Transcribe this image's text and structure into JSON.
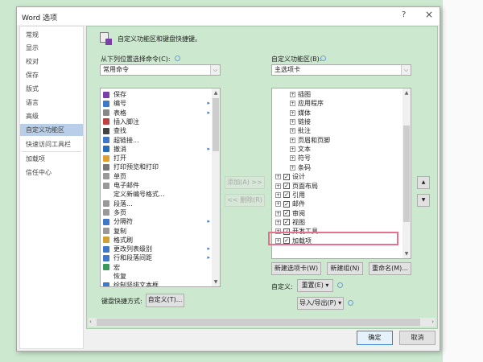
{
  "dialog": {
    "title": "Word 选项",
    "help": "?",
    "close": "×"
  },
  "sidebar": {
    "items": [
      {
        "label": "常规"
      },
      {
        "label": "显示"
      },
      {
        "label": "校对"
      },
      {
        "label": "保存"
      },
      {
        "label": "版式"
      },
      {
        "label": "语言"
      },
      {
        "label": "高级"
      },
      {
        "label": "自定义功能区",
        "selected": true
      },
      {
        "label": "快速访问工具栏"
      },
      {
        "label": "加载项"
      },
      {
        "label": "信任中心"
      }
    ]
  },
  "main": {
    "heading": "自定义功能区和键盘快捷键。",
    "commands_label": "从下列位置选择命令(C):",
    "commands_value": "常用命令",
    "ribbon_label": "自定义功能区(B):",
    "ribbon_value": "主选项卡",
    "commands": [
      {
        "label": "保存",
        "color": "#7a3fa8"
      },
      {
        "label": "编号",
        "color": "#3f78c8",
        "sub": true
      },
      {
        "label": "表格",
        "color": "#888",
        "sub": true
      },
      {
        "label": "插入脚注",
        "color": "#c04040"
      },
      {
        "label": "查找",
        "color": "#444"
      },
      {
        "label": "超链接...",
        "color": "#3f78c8"
      },
      {
        "label": "撤消",
        "color": "#2b6cb8",
        "sub": true
      },
      {
        "label": "打开",
        "color": "#e0a030"
      },
      {
        "label": "打印预览和打印",
        "color": "#777"
      },
      {
        "label": "单页",
        "color": "#999"
      },
      {
        "label": "电子邮件",
        "color": "#999"
      },
      {
        "label": "定义新编号格式...",
        "color": ""
      },
      {
        "label": "段落...",
        "color": "#999"
      },
      {
        "label": "多页",
        "color": "#999"
      },
      {
        "label": "分隔符",
        "color": "#3f78c8",
        "sub": true
      },
      {
        "label": "复制",
        "color": "#999"
      },
      {
        "label": "格式刷",
        "color": "#d0a030"
      },
      {
        "label": "更改列表级别",
        "color": "#3f78c8",
        "sub": true
      },
      {
        "label": "行和段落间距",
        "color": "#3f78c8",
        "sub": true
      },
      {
        "label": "宏",
        "color": "#3a9a5a"
      },
      {
        "label": "恢复",
        "color": ""
      },
      {
        "label": "绘制竖排文本框",
        "color": "#3f78c8"
      }
    ],
    "add_button": "添加(A) >>",
    "remove_button": "<< 删除(R)",
    "ribbon_items": [
      {
        "label": "插图",
        "level": 2
      },
      {
        "label": "应用程序",
        "level": 2
      },
      {
        "label": "媒体",
        "level": 2
      },
      {
        "label": "链接",
        "level": 2
      },
      {
        "label": "批注",
        "level": 2
      },
      {
        "label": "页眉和页脚",
        "level": 2
      },
      {
        "label": "文本",
        "level": 2
      },
      {
        "label": "符号",
        "level": 2
      },
      {
        "label": "条码",
        "level": 2
      },
      {
        "label": "设计",
        "level": 1,
        "checked": true
      },
      {
        "label": "页面布局",
        "level": 1,
        "checked": true
      },
      {
        "label": "引用",
        "level": 1,
        "checked": true
      },
      {
        "label": "邮件",
        "level": 1,
        "checked": true
      },
      {
        "label": "审阅",
        "level": 1,
        "checked": true
      },
      {
        "label": "视图",
        "level": 1,
        "checked": true
      },
      {
        "label": "开发工具",
        "level": 1,
        "checked": true,
        "highlighted": true
      },
      {
        "label": "加载项",
        "level": 1,
        "checked": true
      }
    ],
    "new_tab_button": "新建选项卡(W)",
    "new_group_button": "新建组(N)",
    "rename_button": "重命名(M)...",
    "customize_label": "自定义:",
    "reset_button": "重置(E) ▾",
    "import_export_button": "导入/导出(P) ▾",
    "keyboard_label": "键盘快捷方式:",
    "keyboard_button": "自定义(T)...",
    "highlight_color": "#e8708e"
  },
  "footer": {
    "ok": "确定",
    "cancel": "取消"
  }
}
